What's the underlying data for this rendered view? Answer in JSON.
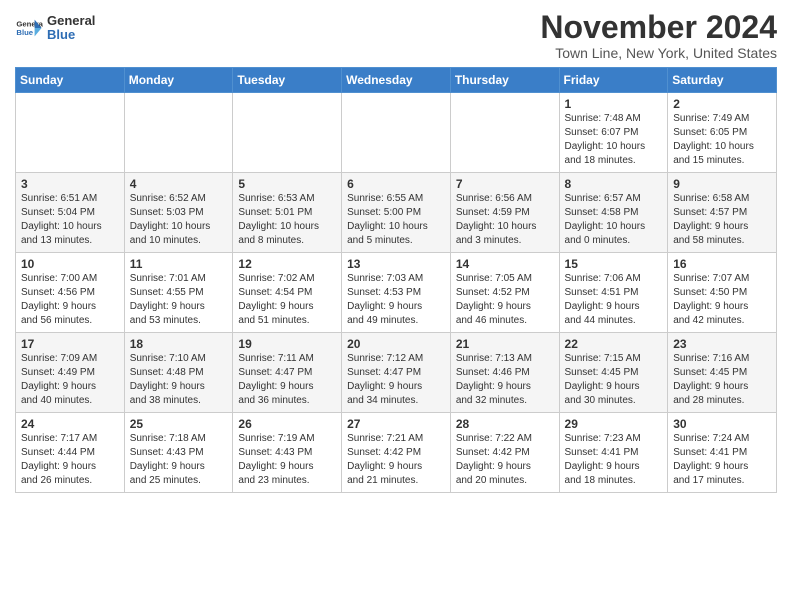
{
  "header": {
    "logo": {
      "general": "General",
      "blue": "Blue"
    },
    "title": "November 2024",
    "subtitle": "Town Line, New York, United States"
  },
  "calendar": {
    "weekdays": [
      "Sunday",
      "Monday",
      "Tuesday",
      "Wednesday",
      "Thursday",
      "Friday",
      "Saturday"
    ],
    "rows": [
      [
        {
          "day": "",
          "info": ""
        },
        {
          "day": "",
          "info": ""
        },
        {
          "day": "",
          "info": ""
        },
        {
          "day": "",
          "info": ""
        },
        {
          "day": "",
          "info": ""
        },
        {
          "day": "1",
          "info": "Sunrise: 7:48 AM\nSunset: 6:07 PM\nDaylight: 10 hours\nand 18 minutes."
        },
        {
          "day": "2",
          "info": "Sunrise: 7:49 AM\nSunset: 6:05 PM\nDaylight: 10 hours\nand 15 minutes."
        }
      ],
      [
        {
          "day": "3",
          "info": "Sunrise: 6:51 AM\nSunset: 5:04 PM\nDaylight: 10 hours\nand 13 minutes."
        },
        {
          "day": "4",
          "info": "Sunrise: 6:52 AM\nSunset: 5:03 PM\nDaylight: 10 hours\nand 10 minutes."
        },
        {
          "day": "5",
          "info": "Sunrise: 6:53 AM\nSunset: 5:01 PM\nDaylight: 10 hours\nand 8 minutes."
        },
        {
          "day": "6",
          "info": "Sunrise: 6:55 AM\nSunset: 5:00 PM\nDaylight: 10 hours\nand 5 minutes."
        },
        {
          "day": "7",
          "info": "Sunrise: 6:56 AM\nSunset: 4:59 PM\nDaylight: 10 hours\nand 3 minutes."
        },
        {
          "day": "8",
          "info": "Sunrise: 6:57 AM\nSunset: 4:58 PM\nDaylight: 10 hours\nand 0 minutes."
        },
        {
          "day": "9",
          "info": "Sunrise: 6:58 AM\nSunset: 4:57 PM\nDaylight: 9 hours\nand 58 minutes."
        }
      ],
      [
        {
          "day": "10",
          "info": "Sunrise: 7:00 AM\nSunset: 4:56 PM\nDaylight: 9 hours\nand 56 minutes."
        },
        {
          "day": "11",
          "info": "Sunrise: 7:01 AM\nSunset: 4:55 PM\nDaylight: 9 hours\nand 53 minutes."
        },
        {
          "day": "12",
          "info": "Sunrise: 7:02 AM\nSunset: 4:54 PM\nDaylight: 9 hours\nand 51 minutes."
        },
        {
          "day": "13",
          "info": "Sunrise: 7:03 AM\nSunset: 4:53 PM\nDaylight: 9 hours\nand 49 minutes."
        },
        {
          "day": "14",
          "info": "Sunrise: 7:05 AM\nSunset: 4:52 PM\nDaylight: 9 hours\nand 46 minutes."
        },
        {
          "day": "15",
          "info": "Sunrise: 7:06 AM\nSunset: 4:51 PM\nDaylight: 9 hours\nand 44 minutes."
        },
        {
          "day": "16",
          "info": "Sunrise: 7:07 AM\nSunset: 4:50 PM\nDaylight: 9 hours\nand 42 minutes."
        }
      ],
      [
        {
          "day": "17",
          "info": "Sunrise: 7:09 AM\nSunset: 4:49 PM\nDaylight: 9 hours\nand 40 minutes."
        },
        {
          "day": "18",
          "info": "Sunrise: 7:10 AM\nSunset: 4:48 PM\nDaylight: 9 hours\nand 38 minutes."
        },
        {
          "day": "19",
          "info": "Sunrise: 7:11 AM\nSunset: 4:47 PM\nDaylight: 9 hours\nand 36 minutes."
        },
        {
          "day": "20",
          "info": "Sunrise: 7:12 AM\nSunset: 4:47 PM\nDaylight: 9 hours\nand 34 minutes."
        },
        {
          "day": "21",
          "info": "Sunrise: 7:13 AM\nSunset: 4:46 PM\nDaylight: 9 hours\nand 32 minutes."
        },
        {
          "day": "22",
          "info": "Sunrise: 7:15 AM\nSunset: 4:45 PM\nDaylight: 9 hours\nand 30 minutes."
        },
        {
          "day": "23",
          "info": "Sunrise: 7:16 AM\nSunset: 4:45 PM\nDaylight: 9 hours\nand 28 minutes."
        }
      ],
      [
        {
          "day": "24",
          "info": "Sunrise: 7:17 AM\nSunset: 4:44 PM\nDaylight: 9 hours\nand 26 minutes."
        },
        {
          "day": "25",
          "info": "Sunrise: 7:18 AM\nSunset: 4:43 PM\nDaylight: 9 hours\nand 25 minutes."
        },
        {
          "day": "26",
          "info": "Sunrise: 7:19 AM\nSunset: 4:43 PM\nDaylight: 9 hours\nand 23 minutes."
        },
        {
          "day": "27",
          "info": "Sunrise: 7:21 AM\nSunset: 4:42 PM\nDaylight: 9 hours\nand 21 minutes."
        },
        {
          "day": "28",
          "info": "Sunrise: 7:22 AM\nSunset: 4:42 PM\nDaylight: 9 hours\nand 20 minutes."
        },
        {
          "day": "29",
          "info": "Sunrise: 7:23 AM\nSunset: 4:41 PM\nDaylight: 9 hours\nand 18 minutes."
        },
        {
          "day": "30",
          "info": "Sunrise: 7:24 AM\nSunset: 4:41 PM\nDaylight: 9 hours\nand 17 minutes."
        }
      ]
    ]
  }
}
